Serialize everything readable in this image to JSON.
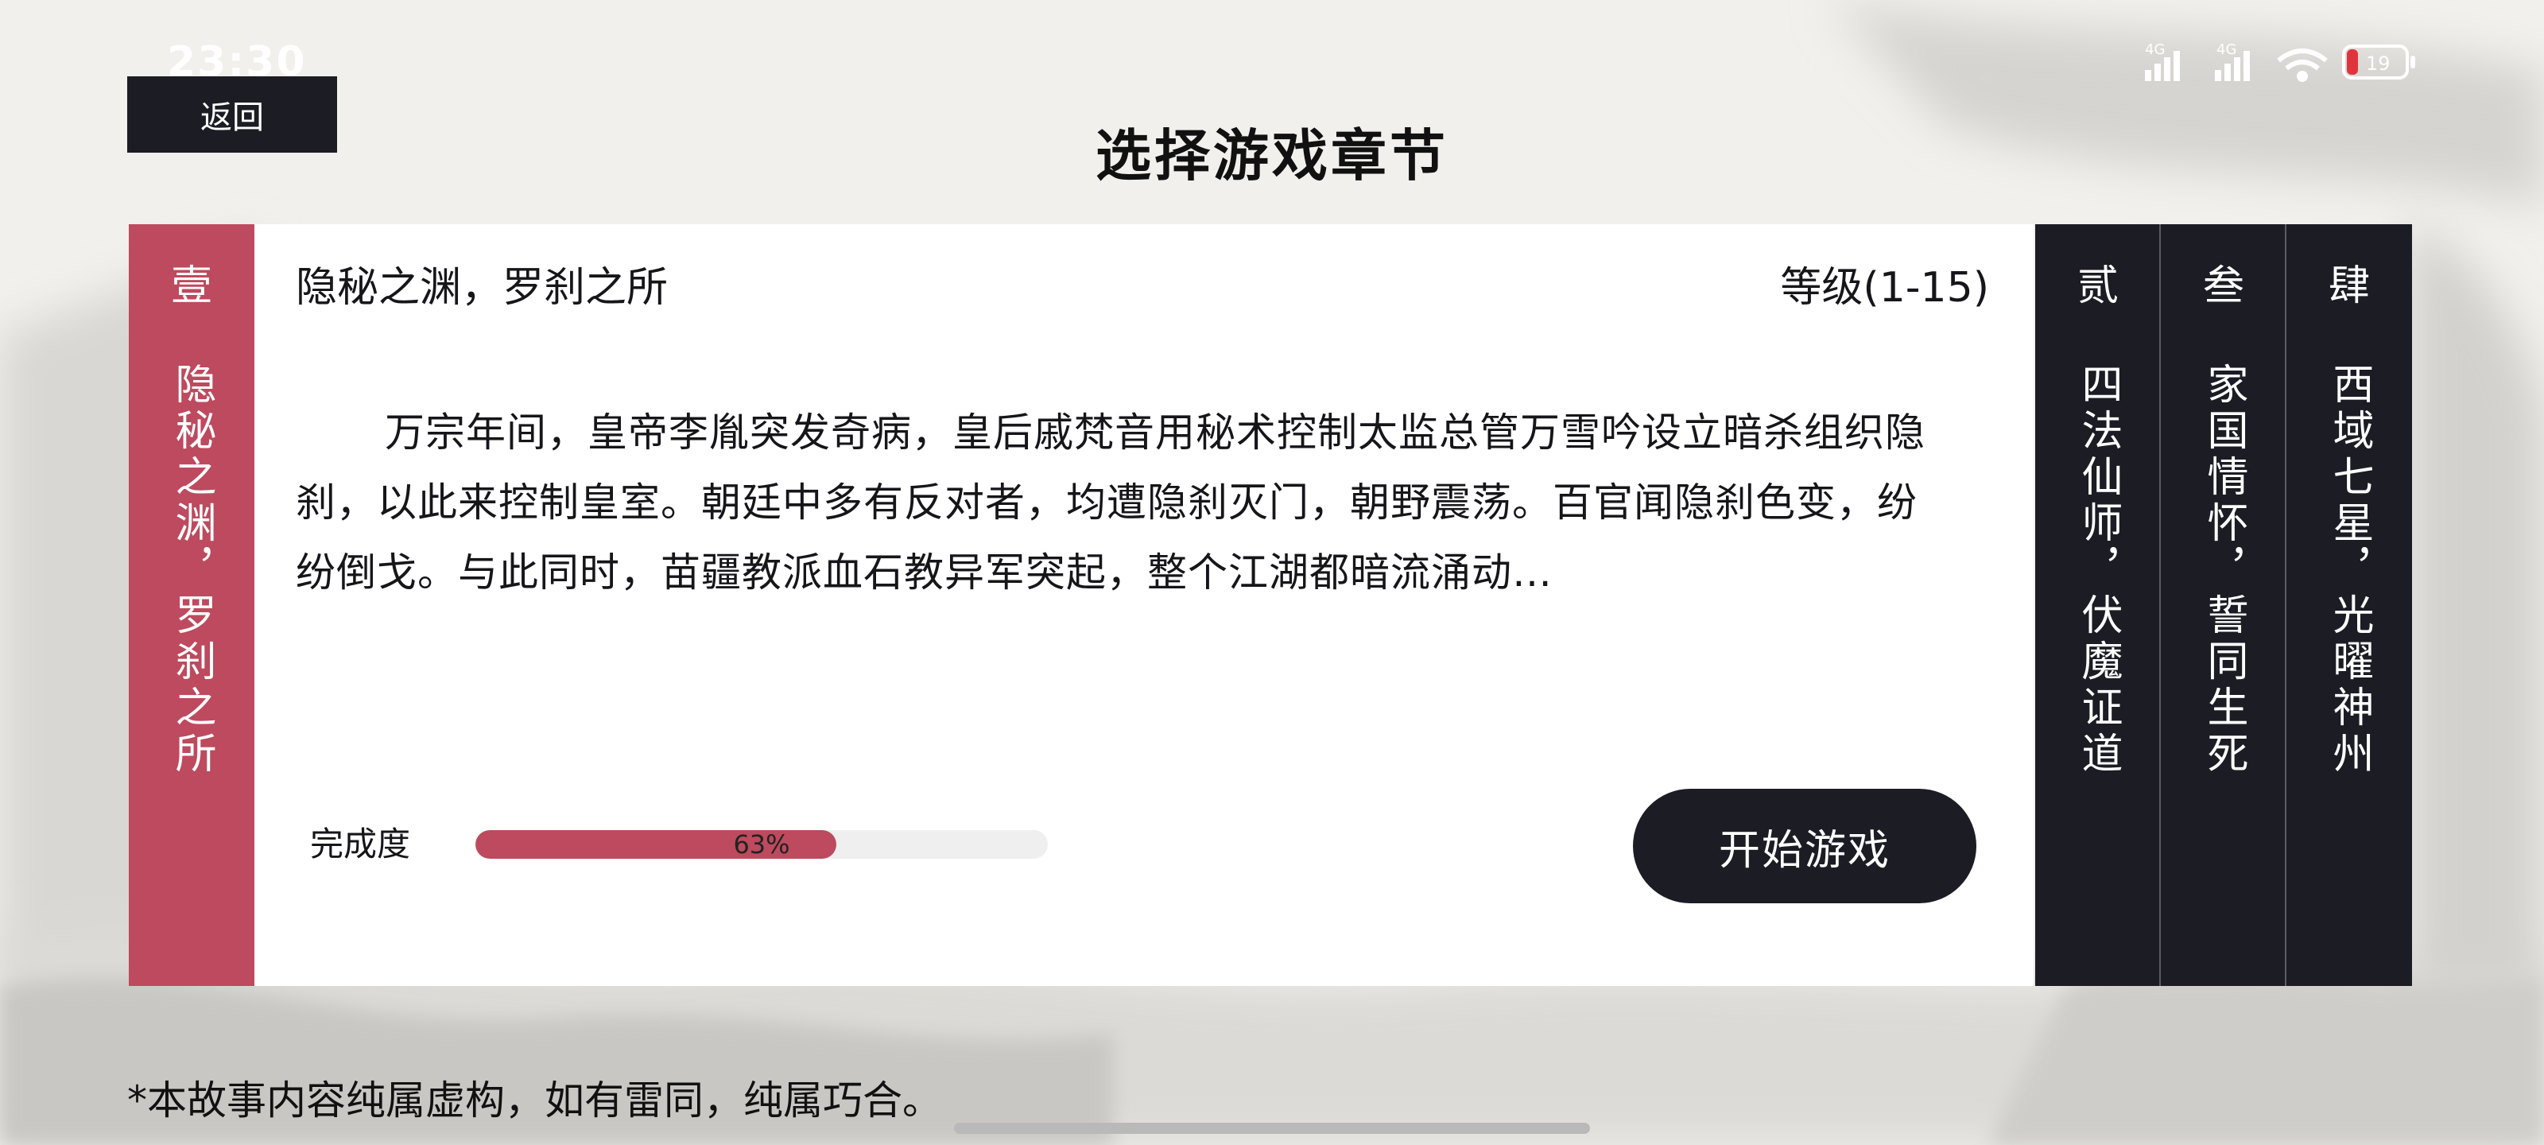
{
  "status_bar": {
    "time": "23:30",
    "network_1": "4G",
    "network_2": "4G",
    "battery": "19"
  },
  "header": {
    "back_label": "返回",
    "title": "选择游戏章节"
  },
  "active_chapter": {
    "number": "壹",
    "strip_title": "隐秘之渊，罗刹之所",
    "title": "隐秘之渊，罗刹之所",
    "level": "等级(1-15)",
    "description": "万宗年间，皇帝李胤突发奇病，皇后戚梵音用秘术控制太监总管万雪吟设立暗杀组织隐刹，以此来控制皇室。朝廷中多有反对者，均遭隐刹灭门，朝野震荡。百官闻隐刹色变，纷纷倒戈。与此同时，苗疆教派血石教异军突起，整个江湖都暗流涌动…",
    "progress_label": "完成度",
    "progress_text": "63%",
    "progress": 0.63,
    "start_label": "开始游戏"
  },
  "other_chapters": [
    {
      "number": "贰",
      "title": "四法仙师，伏魔证道"
    },
    {
      "number": "叁",
      "title": "家国情怀，誓同生死"
    },
    {
      "number": "肆",
      "title": "西域七星，光曜神州"
    }
  ],
  "footer": {
    "disclaimer": "*本故事内容纯属虚构，如有雷同，纯属巧合。"
  },
  "colors": {
    "accent": "#bd4a5e",
    "dark": "#1b1c24",
    "card": "#ffffff",
    "background": "#f1f0ed"
  }
}
